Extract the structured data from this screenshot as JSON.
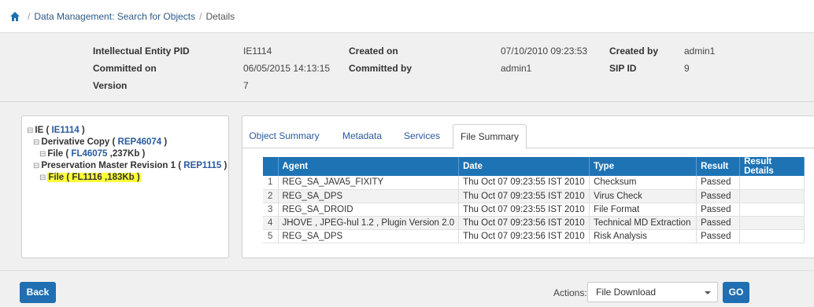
{
  "breadcrumb": {
    "link": "Data Management: Search for Objects",
    "current": "Details"
  },
  "info": {
    "ie_pid_label": "Intellectual Entity PID",
    "ie_pid_value": "IE1114",
    "committed_on_label": "Committed on",
    "committed_on_value": "06/05/2015 14:13:15",
    "version_label": "Version",
    "version_value": "7",
    "created_on_label": "Created on",
    "created_on_value": "07/10/2010 09:23:53",
    "committed_by_label": "Committed by",
    "committed_by_value": "admin1",
    "created_by_label": "Created by",
    "created_by_value": "admin1",
    "sip_id_label": "SIP ID",
    "sip_id_value": "9"
  },
  "tree": {
    "ie_prefix": "IE ( ",
    "ie_id": "IE1114",
    "ie_suffix": " )",
    "deriv_prefix": "Derivative Copy ( ",
    "deriv_id": "REP46074",
    "deriv_suffix": " )",
    "file1_prefix": "File ( ",
    "file1_id": "FL46075",
    "file1_suffix": " ,237Kb )",
    "pres_prefix": "Preservation Master Revision 1 ( ",
    "pres_id": "REP1115",
    "pres_suffix": " )",
    "file2_text": "File ( FL1116 ,183Kb )"
  },
  "tabs": {
    "object_summary": "Object Summary",
    "metadata": "Metadata",
    "services": "Services",
    "file_summary": "File Summary"
  },
  "table": {
    "headers": [
      "Agent",
      "Date",
      "Type",
      "Result",
      "Result Details"
    ],
    "rows": [
      {
        "num": "1",
        "agent": "REG_SA_JAVA5_FIXITY",
        "date": "Thu Oct 07 09:23:55 IST 2010",
        "type": "Checksum",
        "result": "Passed",
        "details": ""
      },
      {
        "num": "2",
        "agent": "REG_SA_DPS",
        "date": "Thu Oct 07 09:23:55 IST 2010",
        "type": "Virus Check",
        "result": "Passed",
        "details": ""
      },
      {
        "num": "3",
        "agent": "REG_SA_DROID",
        "date": "Thu Oct 07 09:23:55 IST 2010",
        "type": "File Format",
        "result": "Passed",
        "details": ""
      },
      {
        "num": "4",
        "agent": "JHOVE , JPEG-hul 1.2 , Plugin Version 2.0",
        "date": "Thu Oct 07 09:23:56 IST 2010",
        "type": "Technical MD Extraction",
        "result": "Passed",
        "details": ""
      },
      {
        "num": "5",
        "agent": "REG_SA_DPS",
        "date": "Thu Oct 07 09:23:56 IST 2010",
        "type": "Risk Analysis",
        "result": "Passed",
        "details": ""
      }
    ]
  },
  "footer": {
    "back_label": "Back",
    "actions_label": "Actions:",
    "select_value": "File Download",
    "go_label": "GO"
  },
  "colors": {
    "accent": "#1f6fb2",
    "highlight": "#ffff3a",
    "link": "#2a5a9e"
  }
}
